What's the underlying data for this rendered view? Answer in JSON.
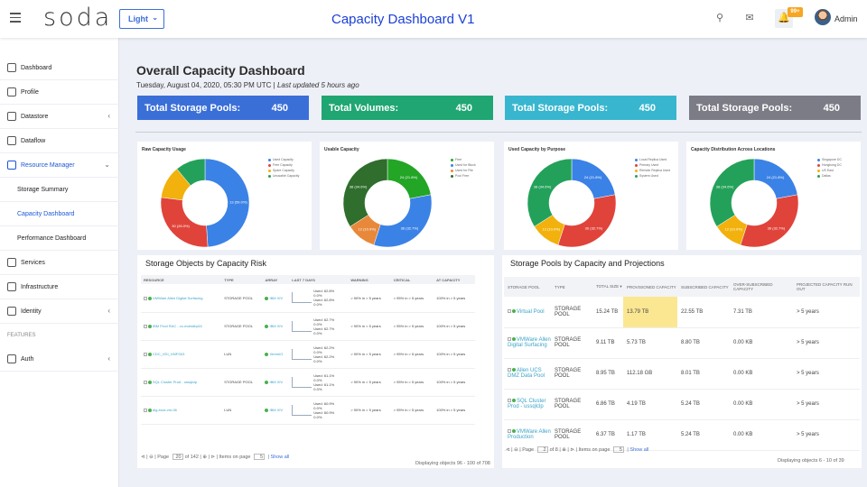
{
  "header": {
    "logo": "soda",
    "theme_label": "Light",
    "title": "Capacity Dashboard V1",
    "notif_badge": "99+",
    "user": "Admin"
  },
  "sidebar": {
    "items": [
      {
        "label": "Dashboard"
      },
      {
        "label": "Profile"
      },
      {
        "label": "Datastore"
      },
      {
        "label": "Dataflow"
      },
      {
        "label": "Resource Manager"
      },
      {
        "label": "Storage Summary"
      },
      {
        "label": "Capacity Dashboard"
      },
      {
        "label": "Performance Dashboard"
      },
      {
        "label": "Services"
      },
      {
        "label": "Infrastructure"
      },
      {
        "label": "Identity"
      },
      {
        "label": "Auth"
      }
    ],
    "section_features": "FEATURES"
  },
  "page": {
    "title": "Overall Capacity Dashboard",
    "date": "Tuesday, August 04, 2020, 05:30 PM UTC |",
    "updated": "Last updated 5 hours ago"
  },
  "summary": [
    {
      "label": "Total Storage Pools:",
      "value": "450",
      "color": "#3b6fd8"
    },
    {
      "label": "Total Volumes:",
      "value": "450",
      "color": "#1fa672"
    },
    {
      "label": "Total Storage Pools:",
      "value": "450",
      "color": "#39b6cf"
    },
    {
      "label": "Total Storage Pools:",
      "value": "450",
      "color": "#7c7c86"
    }
  ],
  "donuts": [
    {
      "title": "Raw Capacity Usage",
      "legend": [
        "Used Capacity",
        "Free Capacity",
        "Spare Capacity",
        "Unusable Capacity"
      ],
      "labels": [
        "13 (59.0%)",
        "30 (28.0%)"
      ],
      "slices": [
        {
          "v": 49,
          "c": "#3b82e6"
        },
        {
          "v": 28,
          "c": "#e0433a"
        },
        {
          "v": 12,
          "c": "#f2b10c"
        },
        {
          "v": 11,
          "c": "#23a15a"
        }
      ]
    },
    {
      "title": "Usable Capacity",
      "legend": [
        "Free",
        "Used for Block",
        "Used for File",
        "Pool Free"
      ],
      "labels": [
        "24 (21.8%)",
        "36 (32.7%)",
        "12 (10.9%)",
        "38 (34.6%)"
      ],
      "slices": [
        {
          "v": 22,
          "c": "#23a526"
        },
        {
          "v": 33,
          "c": "#3b82e6"
        },
        {
          "v": 11,
          "c": "#e8883a"
        },
        {
          "v": 34,
          "c": "#2f6e2c"
        }
      ]
    },
    {
      "title": "Used Capacity by Purpose",
      "legend": [
        "Local Replica Used",
        "Primary Used",
        "Remote Replica Used",
        "System Used"
      ],
      "labels": [
        "24 (21.8%)",
        "36 (32.7%)",
        "12 (10.9%)",
        "38 (34.6%)"
      ],
      "slices": [
        {
          "v": 22,
          "c": "#3b82e6"
        },
        {
          "v": 33,
          "c": "#e0433a"
        },
        {
          "v": 11,
          "c": "#f2b10c"
        },
        {
          "v": 34,
          "c": "#23a15a"
        }
      ]
    },
    {
      "title": "Capacity Distribution Across Locations",
      "legend": [
        "Singapore DC",
        "Hongkong DC",
        "US East",
        "Dallas"
      ],
      "labels": [
        "24 (21.8%)",
        "36 (32.7%)",
        "12 (10.9%)",
        "38 (34.6%)"
      ],
      "slices": [
        {
          "v": 22,
          "c": "#3b82e6"
        },
        {
          "v": 33,
          "c": "#e0433a"
        },
        {
          "v": 11,
          "c": "#f2b10c"
        },
        {
          "v": 34,
          "c": "#23a15a"
        }
      ]
    }
  ],
  "risk": {
    "title": "Storage Objects by Capacity Risk",
    "columns": [
      "RESOURCE",
      "TYPE",
      "ARRAY",
      "LAST 7 DAYS",
      "WARNING",
      "CRITICAL",
      "AT CAPACITY"
    ],
    "rows": [
      {
        "res": "VMWare Allen Digital Surfacing",
        "type": "STORAGE POOL",
        "array": "IBM XIV",
        "u1": "Used: 62.8%",
        "u1b": "0.0%",
        "u2": "Used: 62.8%",
        "u2b": "0.0%",
        "warn": "> 90% in > 5 years",
        "crit": "> 95% in > 5 years",
        "cap": "100% in > 5 years"
      },
      {
        "res": "IBM Prod RAC - vc-mdmdbp01",
        "type": "STORAGE POOL",
        "array": "IBM XIV",
        "u1": "Used: 62.7%",
        "u1b": "0.0%",
        "u2": "Used: 62.7%",
        "u2b": "0.0%",
        "warn": "> 90% in > 5 years",
        "crit": "> 95% in > 5 years",
        "cap": "100% in > 5 years"
      },
      {
        "res": "CDC_VDI_VMFS03",
        "type": "LUN",
        "array": "XtremIO",
        "u1": "Used: 62.2%",
        "u1b": "0.0%",
        "u2": "Used: 62.2%",
        "u2b": "0.0%",
        "warn": "> 90% in > 5 years",
        "crit": "> 95% in > 5 years",
        "cap": "100% in > 5 years"
      },
      {
        "res": "SQL Cluster Prod - ussqlclp",
        "type": "STORAGE POOL",
        "array": "IBM XIV",
        "u1": "Used: 61.1%",
        "u1b": "0.0%",
        "u2": "Used: 61.1%",
        "u2b": "0.0%",
        "warn": "> 90% in > 5 years",
        "crit": "> 95% in > 5 years",
        "cap": "100% in > 5 years"
      },
      {
        "res": "dig-boot-vm-06",
        "type": "LUN",
        "array": "IBM XIV",
        "u1": "Used: 60.9%",
        "u1b": "0.0%",
        "u2": "Used: 60.9%",
        "u2b": "0.0%",
        "warn": "> 90% in > 5 years",
        "crit": "> 95% in > 5 years",
        "cap": "100% in > 5 years"
      }
    ],
    "pager": {
      "page_label": "Page",
      "page": "20",
      "of": "of 142",
      "items_label": "Items on page",
      "items": "5",
      "show_all": "Show all"
    },
    "display": "Displaying objects 96 - 100 of 708"
  },
  "pools": {
    "title": "Storage Pools by Capacity and Projections",
    "columns": [
      "STORAGE POOL",
      "TYPE",
      "TOTAL SIZE ▾",
      "PROVISIONED CAPACITY",
      "SUBSCRIBED CAPACITY",
      "OVER-SUBSCRIBED CAPACITY",
      "PROJECTED CAPACITY RUN OUT"
    ],
    "rows": [
      {
        "pool": "Virtual Pool",
        "type": "STORAGE POOL",
        "total": "15.24 TB",
        "prov": "13.79 TB",
        "sub": "22.55 TB",
        "over": "7.31 TB",
        "proj": "> 5 years"
      },
      {
        "pool": "VMWare Allen Digital Surfacing",
        "type": "STORAGE POOL",
        "total": "9.11 TB",
        "prov": "5.73 TB",
        "sub": "8.80 TB",
        "over": "0.00 KB",
        "proj": "> 5 years"
      },
      {
        "pool": "Allen UCS DMZ Data Pool",
        "type": "STORAGE POOL",
        "total": "8.95 TB",
        "prov": "112.18 GB",
        "sub": "8.01 TB",
        "over": "0.00 KB",
        "proj": "> 5 years"
      },
      {
        "pool": "SQL Cluster Prod - ussqlclp",
        "type": "STORAGE POOL",
        "total": "6.86 TB",
        "prov": "4.19 TB",
        "sub": "5.24 TB",
        "over": "0.00 KB",
        "proj": "> 5 years"
      },
      {
        "pool": "VMWare Allen Production",
        "type": "STORAGE POOL",
        "total": "6.37 TB",
        "prov": "1.17 TB",
        "sub": "5.24 TB",
        "over": "0.00 KB",
        "proj": "> 5 years"
      }
    ],
    "pager": {
      "page_label": "Page",
      "page": "2",
      "of": "of 8",
      "items_label": "Items on page",
      "items": "5",
      "show_all": "Show all"
    },
    "display": "Displaying objects 6 - 10 of 39"
  }
}
